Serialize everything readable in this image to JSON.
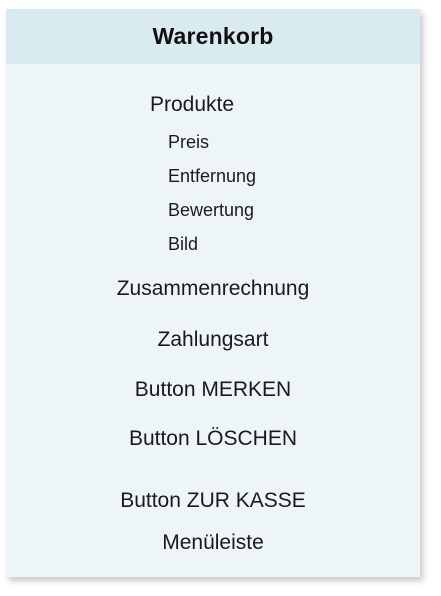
{
  "cart": {
    "title": "Warenkorb",
    "products": {
      "label": "Produkte",
      "attributes": [
        "Preis",
        "Entfernung",
        "Bewertung",
        "Bild"
      ]
    },
    "sections": [
      "Zusammenrechnung",
      "Zahlungsart",
      "Button MERKEN",
      "Button LÖSCHEN",
      "Button ZUR KASSE",
      "Menüleiste"
    ]
  },
  "colors": {
    "header_bg": "#d9ebf0",
    "body_bg": "#eef5f8",
    "text": "#1a1a1a"
  }
}
